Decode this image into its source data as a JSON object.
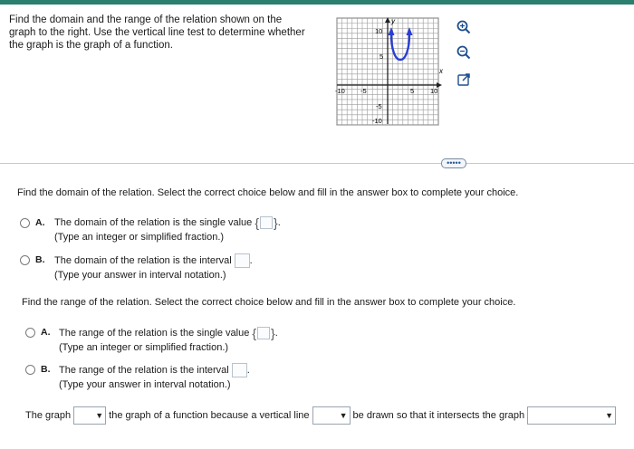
{
  "prompt": {
    "line1": "Find the domain and the range of the relation shown on the",
    "line2": "graph to the right. Use the vertical line test to determine whether",
    "line3": "the graph is the graph of a function."
  },
  "graph": {
    "axis_y": "y",
    "axis_x": "x",
    "tick_10_top": "10",
    "tick_5_top": "5",
    "tick_neg10_left": "-10",
    "tick_neg5_left": "-5",
    "tick_5_right": "5",
    "tick_10_right": "10",
    "tick_neg5_bottom": "-5",
    "tick_neg10_bottom": "-10"
  },
  "toolbar": {
    "zoom_in_icon": "zoom-in-icon",
    "zoom_out_icon": "zoom-out-icon",
    "popout_icon": "external-link-icon"
  },
  "more_button": "•••••",
  "domain": {
    "question": "Find the domain of the relation. Select the correct choice below and fill in the answer box to complete your choice.",
    "a_letter": "A.",
    "a_text": "The domain of the relation is the single value",
    "a_hint": "(Type an integer or simplified fraction.)",
    "b_letter": "B.",
    "b_text": "The domain of the relation is the interval",
    "b_hint": "(Type your answer in interval notation.)"
  },
  "range": {
    "question": "Find the range of the relation. Select the correct choice below and fill in the answer box to complete your choice.",
    "a_letter": "A.",
    "a_text": "The range of the relation is the single value",
    "a_hint": "(Type an integer or simplified fraction.)",
    "b_letter": "B.",
    "b_text": "The range of the relation is the interval",
    "b_hint": "(Type your answer in interval notation.)"
  },
  "sentence": {
    "part1": "The graph",
    "part2": "the graph of a function because a vertical line",
    "part3": "be drawn so that it intersects the graph"
  },
  "colors": {
    "curve": "#2a3fd4",
    "grid": "#9a9a9a",
    "accent": "#2a7f6f"
  }
}
